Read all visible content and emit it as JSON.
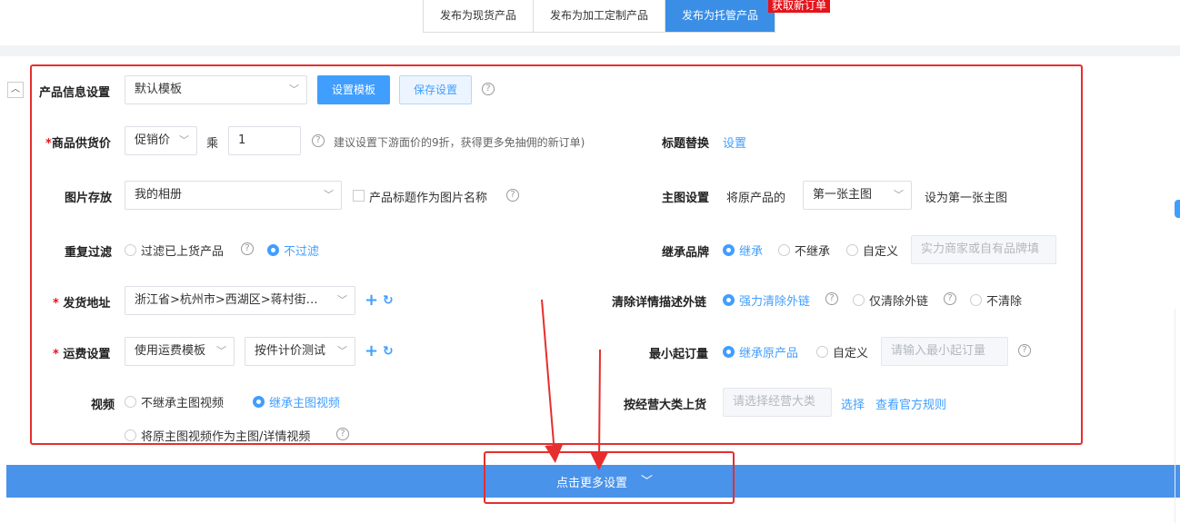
{
  "tabs": [
    "发布为现货产品",
    "发布为加工定制产品",
    "发布为托管产品"
  ],
  "active_tab": 2,
  "badge": "获取新订单",
  "product_info": {
    "label": "产品信息设置",
    "template_value": "默认模板",
    "set_template_btn": "设置模板",
    "save_settings_btn": "保存设置"
  },
  "supply_price": {
    "label": "商品供货价",
    "price_type": "促销价",
    "multiply": "乘",
    "factor": "1",
    "hint": "建议设置下游面价的9折，获得更多免抽佣的新订单)"
  },
  "title_replace": {
    "label": "标题替换",
    "link": "设置"
  },
  "image_storage": {
    "label": "图片存放",
    "album": "我的相册",
    "checkbox_label": "产品标题作为图片名称"
  },
  "main_image": {
    "label": "主图设置",
    "prefix": "将原产品的",
    "select": "第一张主图",
    "suffix": "设为第一张主图"
  },
  "dup_filter": {
    "label": "重复过滤",
    "options": [
      "过滤已上货产品",
      "不过滤"
    ],
    "selected": 1
  },
  "brand": {
    "label": "继承品牌",
    "options": [
      "继承",
      "不继承",
      "自定义"
    ],
    "selected": 0,
    "placeholder": "实力商家或自有品牌填"
  },
  "ship_addr": {
    "label": "发货地址",
    "value": "浙江省>杭州市>西湖区>蒋村街…"
  },
  "clear_links": {
    "label": "清除详情描述外链",
    "options": [
      "强力清除外链",
      "仅清除外链",
      "不清除"
    ],
    "selected": 0
  },
  "freight": {
    "label": "运费设置",
    "template": "使用运费模板",
    "rule": "按件计价测试"
  },
  "min_order": {
    "label": "最小起订量",
    "options": [
      "继承原产品",
      "自定义"
    ],
    "selected": 0,
    "placeholder": "请输入最小起订量"
  },
  "video": {
    "label": "视频",
    "options": [
      "不继承主图视频",
      "继承主图视频",
      "将原主图视频作为主图/详情视频"
    ],
    "selected": 1
  },
  "category": {
    "label": "按经营大类上货",
    "placeholder": "请选择经营大类",
    "select_link": "选择",
    "rules_link": "查看官方规则"
  },
  "more_settings": "点击更多设置",
  "colors": {
    "primary": "#409eff",
    "highlight": "#e62e2e",
    "bar": "#4a93ea"
  }
}
